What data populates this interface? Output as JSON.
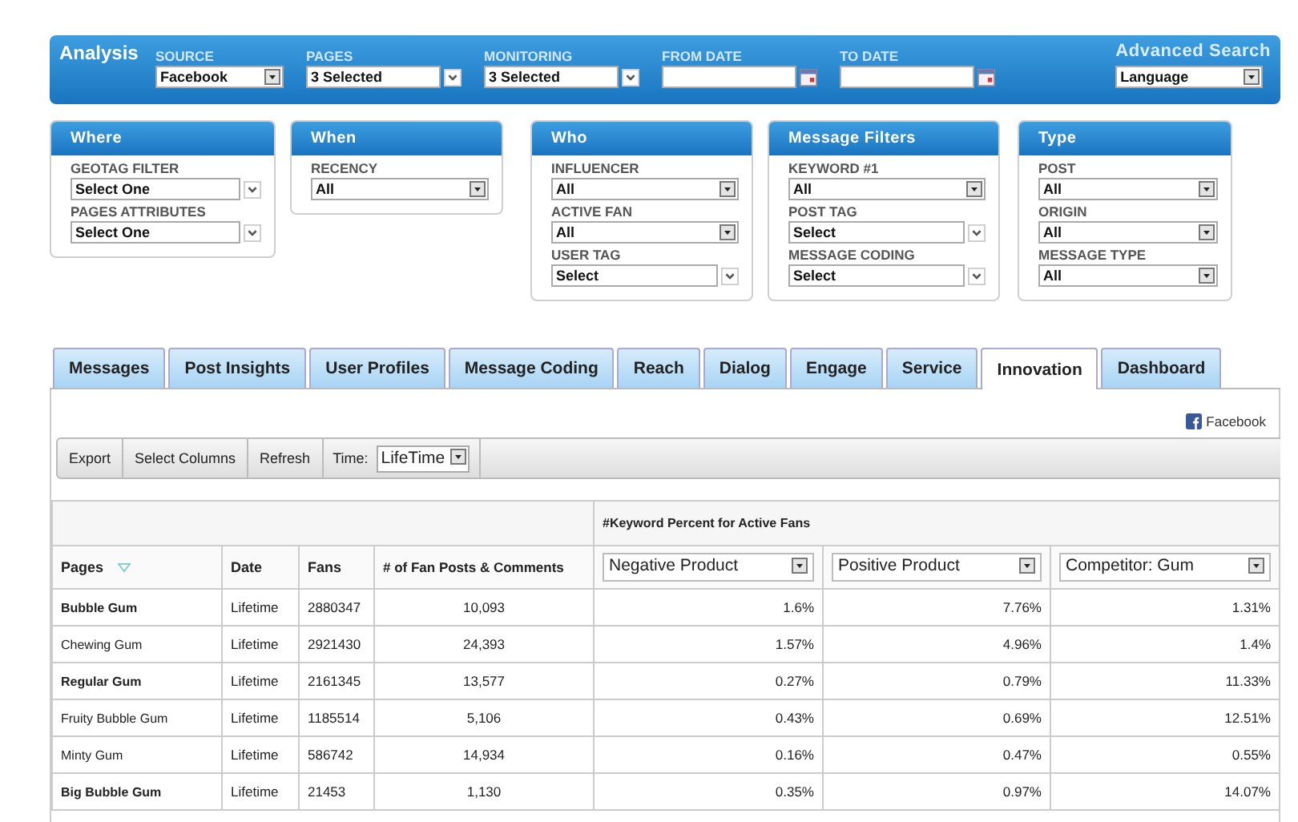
{
  "top_bar": {
    "title": "Analysis",
    "fields": [
      {
        "label": "SOURCE",
        "value": "Facebook",
        "kind": "box"
      },
      {
        "label": "PAGES",
        "value": "3 Selected",
        "kind": "chevron"
      },
      {
        "label": "MONITORING",
        "value": "3 Selected",
        "kind": "chevron"
      },
      {
        "label": "FROM DATE",
        "kind": "date"
      },
      {
        "label": "TO DATE",
        "kind": "date"
      }
    ],
    "advanced": {
      "label": "Advanced Search",
      "value": "Language",
      "kind": "box"
    }
  },
  "panels": [
    {
      "title": "Where",
      "fields": [
        {
          "label": "GEOTAG FILTER",
          "value": "Select One",
          "kind": "chevron"
        },
        {
          "label": "PAGES ATTRIBUTES",
          "value": "Select One",
          "kind": "chevron"
        }
      ]
    },
    {
      "title": "When",
      "fields": [
        {
          "label": "RECENCY",
          "value": "All",
          "kind": "box"
        }
      ]
    },
    {
      "title": "Who",
      "fields": [
        {
          "label": "INFLUENCER",
          "value": "All",
          "kind": "box"
        },
        {
          "label": "ACTIVE FAN",
          "value": "All",
          "kind": "box"
        },
        {
          "label": "USER TAG",
          "value": "Select",
          "kind": "chevron"
        }
      ]
    },
    {
      "title": "Message Filters",
      "fields": [
        {
          "label": "KEYWORD #1",
          "value": "All",
          "kind": "box"
        },
        {
          "label": "POST TAG",
          "value": "Select",
          "kind": "chevron"
        },
        {
          "label": "MESSAGE CODING",
          "value": "Select",
          "kind": "chevron"
        }
      ]
    },
    {
      "title": "Type",
      "fields": [
        {
          "label": "POST",
          "value": "All",
          "kind": "box"
        },
        {
          "label": "ORIGIN",
          "value": "All",
          "kind": "box"
        },
        {
          "label": "MESSAGE TYPE",
          "value": "All",
          "kind": "box"
        }
      ]
    }
  ],
  "tabs": [
    {
      "label": "Messages",
      "selected": false
    },
    {
      "label": "Post Insights",
      "selected": false
    },
    {
      "label": "User Profiles",
      "selected": false
    },
    {
      "label": "Message Coding",
      "selected": false
    },
    {
      "label": "Reach",
      "selected": false
    },
    {
      "label": "Dialog",
      "selected": false
    },
    {
      "label": "Engage",
      "selected": false
    },
    {
      "label": "Service",
      "selected": false
    },
    {
      "label": "Innovation",
      "selected": true
    },
    {
      "label": "Dashboard",
      "selected": false
    }
  ],
  "source_link": "Facebook",
  "toolbar": {
    "buttons": [
      "Export",
      "Select Columns",
      "Refresh"
    ],
    "time_label": "Time:",
    "time_value": "LifeTime"
  },
  "table": {
    "group_header": "#Keyword Percent for Active Fans",
    "columns": [
      "Pages",
      "Date",
      "Fans",
      "# of Fan Posts & Comments"
    ],
    "keyword_columns": [
      "Negative Product",
      "Positive Product",
      "Competitor: Gum"
    ],
    "rows": [
      {
        "page": "Bubble Gum",
        "bold": true,
        "date": "Lifetime",
        "fans": "2880347",
        "posts": "10,093",
        "values": [
          "1.6%",
          "7.76%",
          "1.31%"
        ]
      },
      {
        "page": "Chewing Gum",
        "bold": false,
        "date": "Lifetime",
        "fans": "2921430",
        "posts": "24,393",
        "values": [
          "1.57%",
          "4.96%",
          "1.4%"
        ]
      },
      {
        "page": "Regular Gum",
        "bold": true,
        "date": "Lifetime",
        "fans": "2161345",
        "posts": "13,577",
        "values": [
          "0.27%",
          "0.79%",
          "11.33%"
        ]
      },
      {
        "page": "Fruity Bubble Gum",
        "bold": false,
        "date": "Lifetime",
        "fans": "1185514",
        "posts": "5,106",
        "values": [
          "0.43%",
          "0.69%",
          "12.51%"
        ]
      },
      {
        "page": "Minty Gum",
        "bold": false,
        "date": "Lifetime",
        "fans": "586742",
        "posts": "14,934",
        "values": [
          "0.16%",
          "0.47%",
          "0.55%"
        ]
      },
      {
        "page": "Big Bubble Gum",
        "bold": true,
        "date": "Lifetime",
        "fans": "21453",
        "posts": "1,130",
        "values": [
          "0.35%",
          "0.97%",
          "14.07%"
        ]
      }
    ]
  }
}
